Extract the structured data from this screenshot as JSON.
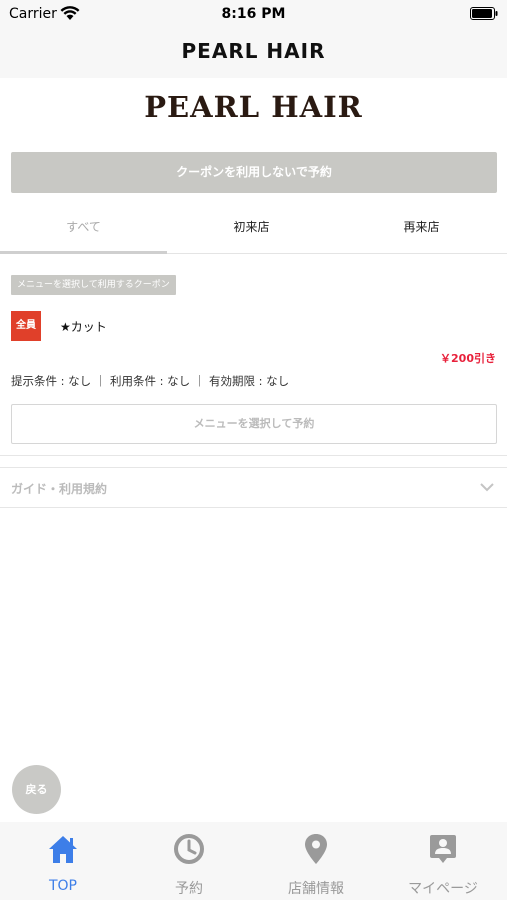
{
  "status_bar": {
    "carrier": "Carrier",
    "time": "8:16 PM"
  },
  "nav": {
    "title": "PEARL HAIR"
  },
  "logo": {
    "text": "PEARL HAIR"
  },
  "no_coupon_button": "クーポンを利用しないで予約",
  "tabs": [
    {
      "label": "すべて"
    },
    {
      "label": "初来店"
    },
    {
      "label": "再来店"
    }
  ],
  "coupon": {
    "tag": "メニューを選択して利用するクーポン",
    "badge": "全員",
    "title": "★カット",
    "discount": "￥200引き",
    "conditions": "提示条件 : なし ｜ 利用条件 : なし ｜ 有効期限 : なし",
    "reserve_button": "メニューを選択して予約"
  },
  "guide": {
    "label": "ガイド・利用規約"
  },
  "back_button": "戻る",
  "bottom_tabs": [
    {
      "label": "TOP",
      "icon": "home-icon",
      "active": true
    },
    {
      "label": "予約",
      "icon": "clock-icon",
      "active": false
    },
    {
      "label": "店舗情報",
      "icon": "map-pin-icon",
      "active": false
    },
    {
      "label": "マイページ",
      "icon": "profile-icon",
      "active": false
    }
  ],
  "colors": {
    "accent": "#3d7ee8",
    "discount": "#e8213b",
    "badge": "#e0402a",
    "button_gray": "#c8c8c4"
  }
}
